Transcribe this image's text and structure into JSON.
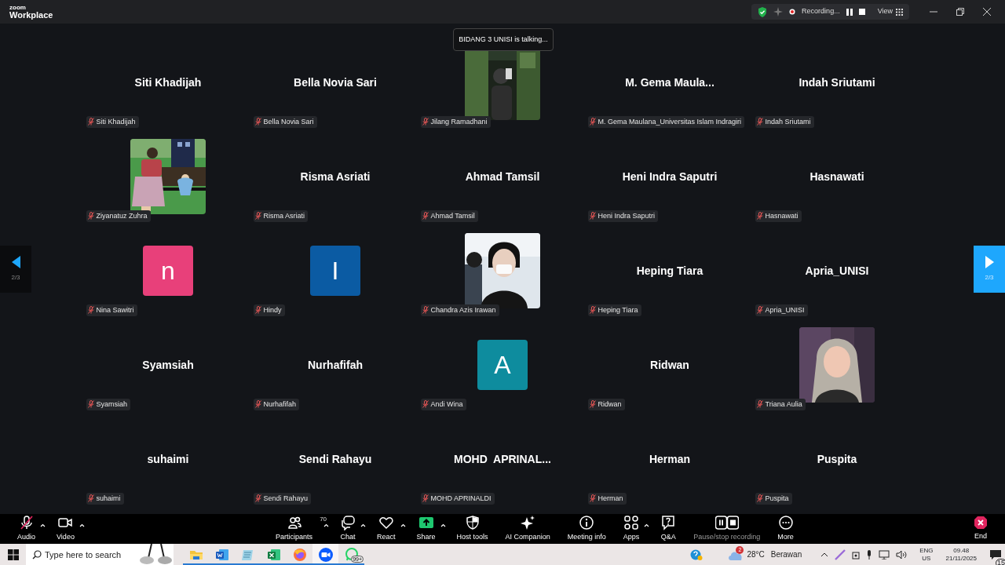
{
  "app": {
    "logo_top": "zoom",
    "logo_bottom": "Workplace"
  },
  "top_bar": {
    "recording_label": "Recording...",
    "view_label": "View"
  },
  "talking_toast": "BIDANG 3 UNISI is talking...",
  "pager": {
    "previous_label": "2/3",
    "next_label": "2/3"
  },
  "tiles": [
    {
      "kind": "name",
      "display": "Siti Khadijah",
      "label": "Siti Khadijah",
      "muted": true
    },
    {
      "kind": "name",
      "display": "Bella Novia Sari",
      "label": "Bella Novia Sari",
      "muted": true
    },
    {
      "kind": "picture",
      "label": "Jilang Ramadhani",
      "muted": true
    },
    {
      "kind": "name",
      "display": "M. Gema Maula...",
      "label": "M. Gema Maulana_Universitas Islam Indragiri",
      "muted": true
    },
    {
      "kind": "name",
      "display": "Indah Sriutami",
      "label": "Indah Sriutami",
      "muted": true
    },
    {
      "kind": "picture",
      "label": "Ziyanatuz Zuhra",
      "muted": true
    },
    {
      "kind": "name",
      "display": "Risma Asriati",
      "label": "Risma Asriati",
      "muted": true
    },
    {
      "kind": "name",
      "display": "Ahmad Tamsil",
      "label": "Ahmad Tamsil",
      "muted": true
    },
    {
      "kind": "name",
      "display": "Heni Indra Saputri",
      "label": "Heni Indra Saputri",
      "muted": true
    },
    {
      "kind": "name",
      "display": "Hasnawati",
      "label": "Hasnawati",
      "muted": true
    },
    {
      "kind": "avatar",
      "letter": "n",
      "color": "#e8407a",
      "label": "Nina Sawitri",
      "muted": true
    },
    {
      "kind": "avatar",
      "letter": "I",
      "color": "#0b5ba3",
      "label": "Hindy",
      "muted": true
    },
    {
      "kind": "picture",
      "label": "Chandra Azis Irawan",
      "muted": true
    },
    {
      "kind": "name",
      "display": "Heping Tiara",
      "label": "Heping Tiara",
      "muted": true
    },
    {
      "kind": "name",
      "display": "Apria_UNISI",
      "label": "Apria_UNISI",
      "muted": true
    },
    {
      "kind": "name",
      "display": "Syamsiah",
      "label": "Syamsiah",
      "muted": true
    },
    {
      "kind": "name",
      "display": "Nurhafifah",
      "label": "Nurhafifah",
      "muted": true
    },
    {
      "kind": "avatar",
      "letter": "A",
      "color": "#0e8c9e",
      "label": "Andi Wina",
      "muted": true
    },
    {
      "kind": "name",
      "display": "Ridwan",
      "label": "Ridwan",
      "muted": true
    },
    {
      "kind": "picture",
      "label": "Triana Aulia",
      "muted": true
    },
    {
      "kind": "name",
      "display": "suhaimi",
      "label": "suhaimi",
      "muted": true
    },
    {
      "kind": "name",
      "display": "Sendi Rahayu",
      "label": "Sendi Rahayu",
      "muted": true
    },
    {
      "kind": "name",
      "display": "MOHD  APRINAL...",
      "label": "MOHD APRINALDI",
      "muted": true
    },
    {
      "kind": "name",
      "display": "Herman",
      "label": "Herman",
      "muted": true
    },
    {
      "kind": "name",
      "display": "Puspita",
      "label": "Puspita",
      "muted": true
    }
  ],
  "toolbar": [
    {
      "label": "Audio",
      "caret": true,
      "disabled": false
    },
    {
      "label": "Video",
      "caret": true,
      "disabled": false
    },
    {
      "label": "Participants",
      "badge": "70",
      "caret": true,
      "disabled": false
    },
    {
      "label": "Chat",
      "caret": true,
      "disabled": false
    },
    {
      "label": "React",
      "caret": true,
      "disabled": false
    },
    {
      "label": "Share",
      "caret": true,
      "disabled": false
    },
    {
      "label": "Host tools",
      "caret": false,
      "disabled": false
    },
    {
      "label": "AI Companion",
      "caret": false,
      "disabled": false
    },
    {
      "label": "Meeting info",
      "caret": false,
      "disabled": false
    },
    {
      "label": "Apps",
      "caret": true,
      "disabled": false
    },
    {
      "label": "Q&A",
      "caret": false,
      "disabled": false
    },
    {
      "label": "Pause/stop recording",
      "caret": false,
      "disabled": true
    },
    {
      "label": "More",
      "caret": false,
      "disabled": false
    }
  ],
  "end_button": {
    "label": "End"
  },
  "taskbar": {
    "search_placeholder": "Type here to search",
    "apps": [
      {
        "running": true,
        "selected": false
      },
      {
        "running": true,
        "selected": false
      },
      {
        "running": true,
        "selected": false
      },
      {
        "running": true,
        "selected": false
      },
      {
        "running": true,
        "selected": false
      },
      {
        "running": true,
        "selected": true
      },
      {
        "running": true,
        "selected": false,
        "badge": "99+"
      }
    ],
    "weather": {
      "badge": "2",
      "temperature": "28°C",
      "condition": "Berawan"
    },
    "language": {
      "top": "ENG",
      "bottom": "US"
    },
    "time": "09.48",
    "date": "21/11/2025",
    "notifications": "15"
  }
}
